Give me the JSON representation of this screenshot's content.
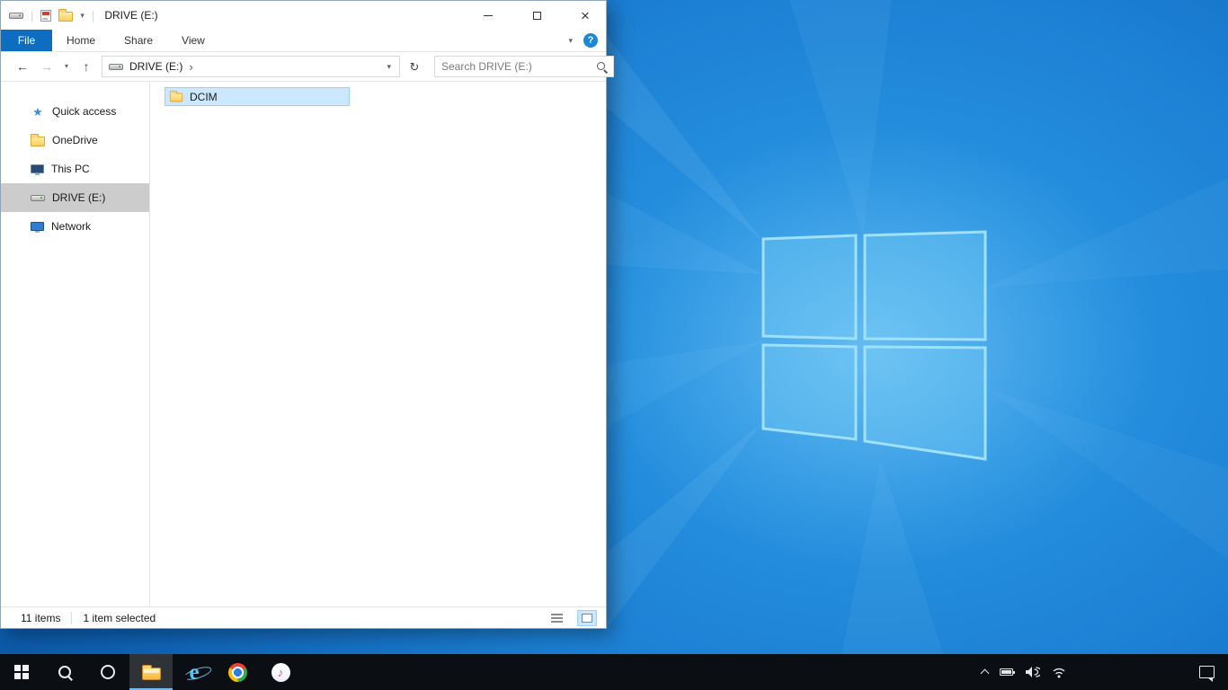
{
  "explorer": {
    "titlebar": {
      "title": "DRIVE (E:)"
    },
    "ribbon": {
      "file_tab": "File",
      "tabs": [
        "Home",
        "Share",
        "View"
      ]
    },
    "navbar": {
      "breadcrumb_drive": "DRIVE (E:)",
      "search_placeholder": "Search DRIVE (E:)"
    },
    "sidebar": {
      "items": [
        {
          "label": "Quick access",
          "icon": "star-icon"
        },
        {
          "label": "OneDrive",
          "icon": "onedrive-icon"
        },
        {
          "label": "This PC",
          "icon": "this-pc-icon"
        },
        {
          "label": "DRIVE (E:)",
          "icon": "drive-icon",
          "selected": true
        },
        {
          "label": "Network",
          "icon": "network-icon"
        }
      ]
    },
    "content": {
      "folders": [
        {
          "label": "DCIM",
          "selected": true
        }
      ]
    },
    "statusbar": {
      "count": "11 items",
      "selected": "1 item selected"
    }
  },
  "taskbar": {
    "apps": [
      {
        "name": "start"
      },
      {
        "name": "search"
      },
      {
        "name": "cortana"
      },
      {
        "name": "file-explorer",
        "active": true
      },
      {
        "name": "internet-explorer"
      },
      {
        "name": "chrome"
      },
      {
        "name": "itunes"
      }
    ],
    "tray": [
      "hidden-icons-chevron",
      "battery",
      "volume",
      "network"
    ],
    "action_center": "action-center"
  },
  "icons": {
    "back": "←",
    "forward": "→",
    "up": "↑",
    "refresh": "↻",
    "dropdown": "▾",
    "breadcrumb_separator": "›",
    "close": "×",
    "star": "★",
    "help": "?",
    "ie": "e",
    "music_note": "♪"
  },
  "colors": {
    "accent_blue": "#0d6ec1",
    "selection_bg": "#cce8ff",
    "selection_border": "#99d1ff",
    "sidebar_selected": "#cccccc",
    "taskbar_bg": "#0b0f14",
    "desktop_blue": "#1b7ed2"
  }
}
